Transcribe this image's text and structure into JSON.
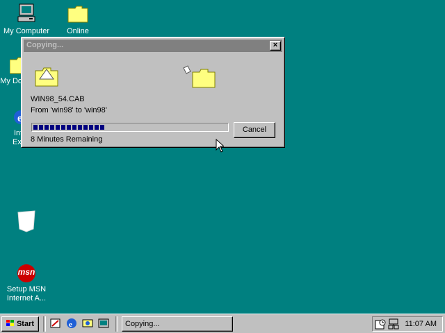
{
  "desktop": {
    "icons": [
      {
        "label": "My Computer"
      },
      {
        "label": "Online"
      },
      {
        "label": "My Do"
      },
      {
        "label": "Int"
      },
      {
        "label": "Ex"
      },
      {
        "label": "Setup MSN"
      },
      {
        "label": "Internet A..."
      }
    ],
    "msn_logo_text": "msn"
  },
  "dialog": {
    "title": "Copying...",
    "close_label": "×",
    "file_name": "WIN98_54.CAB",
    "from_to": "From 'win98' to 'win98'",
    "progress_fraction": 0.39,
    "remaining": "8 Minutes Remaining",
    "cancel_label": "Cancel"
  },
  "taskbar": {
    "start_label": "Start",
    "task_label": "Copying...",
    "clock": "11:07 AM"
  },
  "colors": {
    "desktop": "#008080",
    "progress": "#000080",
    "inactive_title": "#808080"
  }
}
